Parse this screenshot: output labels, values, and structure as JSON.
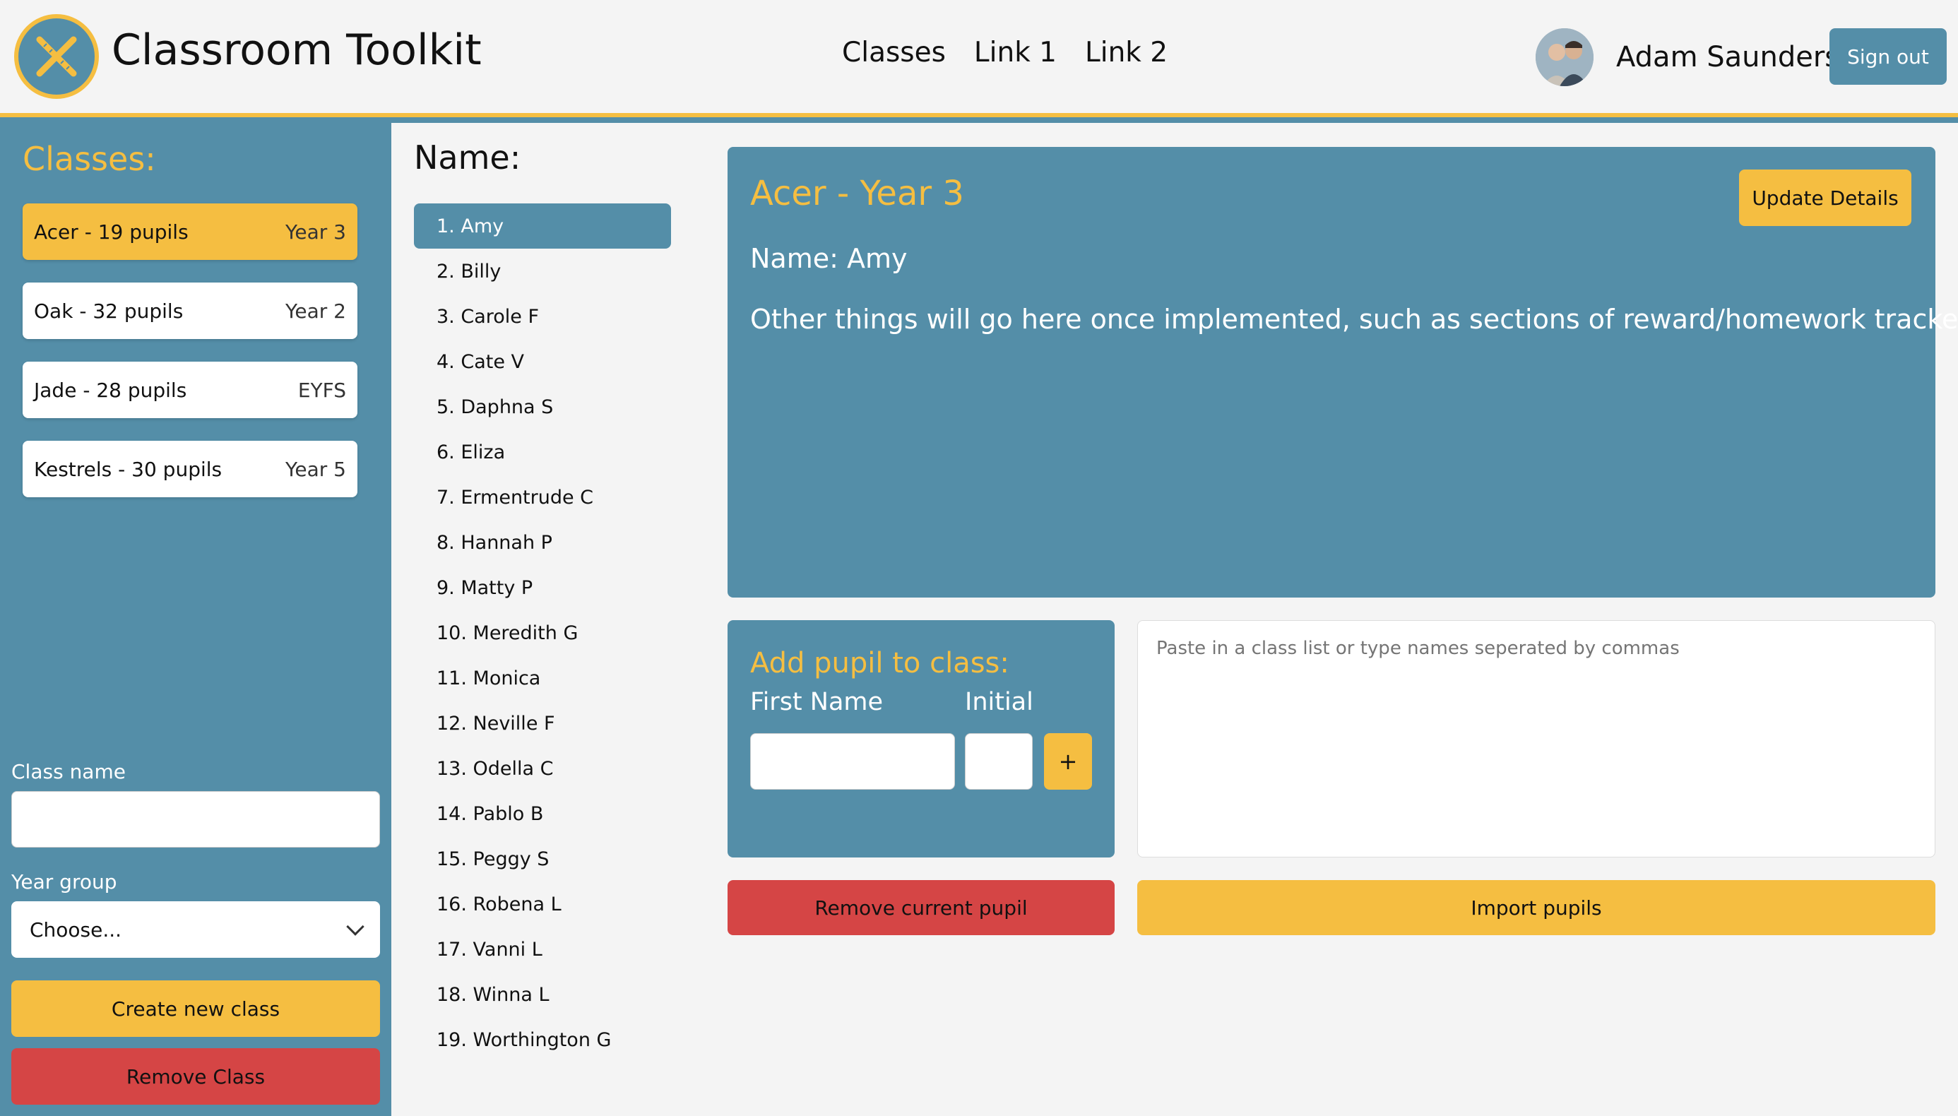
{
  "header": {
    "app_title": "Classroom Toolkit",
    "nav": [
      "Classes",
      "Link 1",
      "Link 2"
    ],
    "username": "Adam Saunders",
    "signout_label": "Sign out"
  },
  "sidebar": {
    "title": "Classes:",
    "classes": [
      {
        "name": "Acer - 19 pupils",
        "year": "Year 3",
        "active": true
      },
      {
        "name": "Oak - 32 pupils",
        "year": "Year 2",
        "active": false
      },
      {
        "name": "Jade - 28 pupils",
        "year": "EYFS",
        "active": false
      },
      {
        "name": "Kestrels - 30 pupils",
        "year": "Year 5",
        "active": false
      }
    ],
    "class_name_label": "Class name",
    "class_name_value": "",
    "year_group_label": "Year group",
    "year_group_value": "Choose...",
    "create_label": "Create new class",
    "remove_label": "Remove Class"
  },
  "pupils": {
    "title": "Name:",
    "list": [
      "1. Amy",
      "2. Billy",
      "3. Carole F",
      "4. Cate V",
      "5. Daphna S",
      "6. Eliza",
      "7. Ermentrude C",
      "8. Hannah P",
      "9. Matty P",
      "10. Meredith G",
      "11. Monica",
      "12. Neville F",
      "13. Odella C",
      "14. Pablo B",
      "15. Peggy S",
      "16. Robena L",
      "17. Vanni L",
      "18. Winna L",
      "19. Worthington G"
    ],
    "active_index": 0
  },
  "detail": {
    "title": "Acer - Year 3",
    "name_line": "Name: Amy",
    "note": "Other things will go here once implemented, such as sections of reward/homework trackers",
    "update_label": "Update Details"
  },
  "add_pupil": {
    "title": "Add pupil to class:",
    "first_name_label": "First Name",
    "initial_label": "Initial",
    "first_name_value": "",
    "initial_value": "",
    "add_label": "+"
  },
  "import": {
    "placeholder": "Paste in a class list or type names seperated by commas",
    "import_label": "Import pupils",
    "remove_pupil_label": "Remove current pupil"
  },
  "colors": {
    "accent_blue": "#548ea8",
    "accent_yellow": "#f5be41",
    "danger_red": "#d54545",
    "background": "#f4f4f4"
  }
}
